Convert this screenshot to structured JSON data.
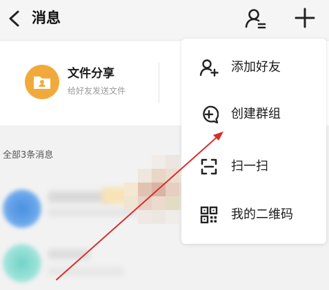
{
  "header": {
    "title": "消息",
    "back_icon": "chevron-left-icon",
    "contacts_icon": "contacts-icon",
    "add_icon": "plus-icon"
  },
  "share_card": {
    "title": "文件分享",
    "subtitle": "给好友发送文件",
    "icon": "folder-icon",
    "icon_color": "#f2a93b"
  },
  "messages": {
    "section_label": "全部3条消息"
  },
  "dropdown_menu": {
    "items": [
      {
        "label": "添加好友",
        "icon": "add-friend-icon"
      },
      {
        "label": "创建群组",
        "icon": "create-group-icon"
      },
      {
        "label": "扫一扫",
        "icon": "scan-icon"
      },
      {
        "label": "我的二维码",
        "icon": "qrcode-icon"
      }
    ]
  },
  "annotation": {
    "arrow_color": "#d92b2b"
  }
}
